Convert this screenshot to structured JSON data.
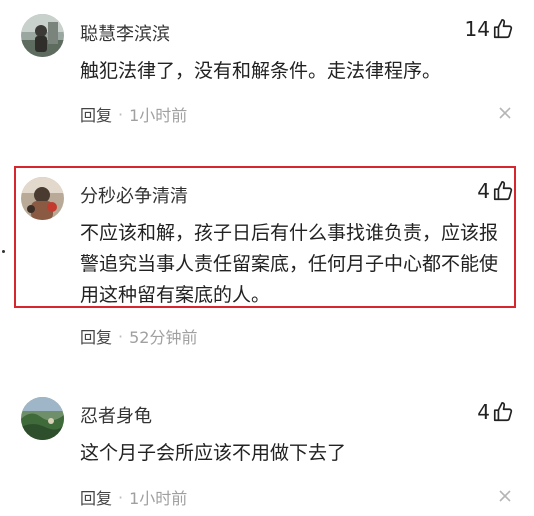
{
  "comments": [
    {
      "username": "聪慧李滨滨",
      "likes": "14",
      "text": "触犯法律了，没有和解条件。走法律程序。",
      "reply_label": "回复",
      "separator": "·",
      "time": "1小时前"
    },
    {
      "username": "分秒必争清清",
      "likes": "4",
      "text": "不应该和解，孩子日后有什么事找谁负责，应该报警追究当事人责任留案底，任何月子中心都不能使用这种留有案底的人。",
      "reply_label": "回复",
      "separator": "·",
      "time": "52分钟前"
    },
    {
      "username": "忍者身龟",
      "likes": "4",
      "text": "这个月子会所应该不用做下去了",
      "reply_label": "回复",
      "separator": "·",
      "time": "1小时前"
    }
  ],
  "highlight_color": "#d6262e",
  "icons": {
    "like": "thumbs-up-icon",
    "close": "close-icon"
  }
}
